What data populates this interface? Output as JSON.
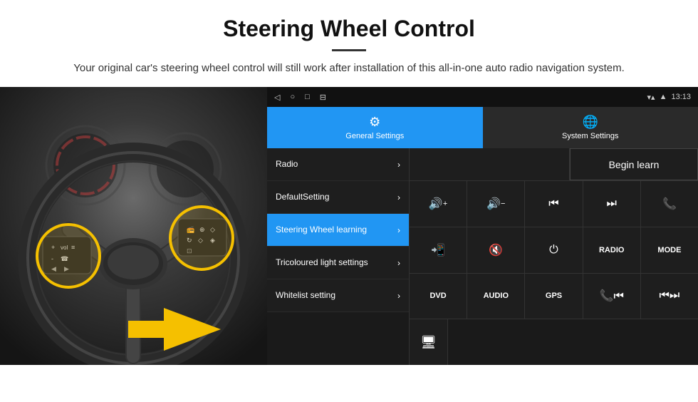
{
  "header": {
    "title": "Steering Wheel Control",
    "description": "Your original car's steering wheel control will still work after installation of this all-in-one auto radio navigation system."
  },
  "statusBar": {
    "time": "13:13",
    "navIcons": [
      "◁",
      "○",
      "□",
      "⊟"
    ]
  },
  "tabs": [
    {
      "id": "general",
      "label": "General Settings",
      "icon": "⚙",
      "active": true
    },
    {
      "id": "system",
      "label": "System Settings",
      "icon": "⊕",
      "active": false
    }
  ],
  "menuItems": [
    {
      "id": "radio",
      "label": "Radio",
      "active": false
    },
    {
      "id": "default",
      "label": "DefaultSetting",
      "active": false
    },
    {
      "id": "steering",
      "label": "Steering Wheel learning",
      "active": true
    },
    {
      "id": "tricolour",
      "label": "Tricoloured light settings",
      "active": false
    },
    {
      "id": "whitelist",
      "label": "Whitelist setting",
      "active": false
    }
  ],
  "beginLearnButton": "Begin learn",
  "controlButtons": {
    "row1": [
      {
        "icon": "🔊+",
        "text": ""
      },
      {
        "icon": "🔊-",
        "text": ""
      },
      {
        "icon": "⏮",
        "text": ""
      },
      {
        "icon": "⏭",
        "text": ""
      },
      {
        "icon": "📞",
        "text": ""
      }
    ],
    "row2": [
      {
        "icon": "📞✓",
        "text": ""
      },
      {
        "icon": "🔇",
        "text": ""
      },
      {
        "icon": "⏻",
        "text": ""
      },
      {
        "text": "RADIO"
      },
      {
        "text": "MODE"
      }
    ],
    "row3": [
      {
        "text": "DVD"
      },
      {
        "text": "AUDIO"
      },
      {
        "text": "GPS"
      },
      {
        "icon": "📞⏮",
        "text": ""
      },
      {
        "icon": "⏮⏭",
        "text": ""
      }
    ]
  }
}
